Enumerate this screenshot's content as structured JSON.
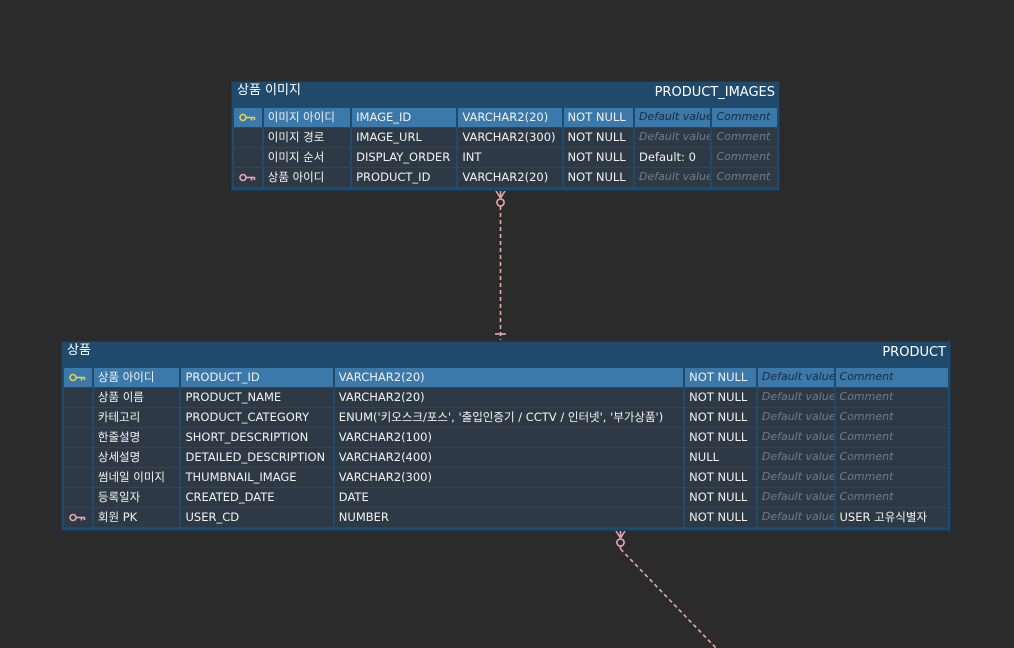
{
  "colors": {
    "canvas_bg": "#2b2b2b",
    "entity_bg": "#1f4a6b",
    "cell_bg": "#2d3a46",
    "selected_row_bg": "#3a79aa",
    "pk_key": "#e3d24a",
    "fk_key": "#e8a6b3",
    "relation_line": "#e8a6b3"
  },
  "entities": {
    "product_images": {
      "logical_name": "상품 이미지",
      "physical_name": "PRODUCT_IMAGES",
      "rows": [
        {
          "key": "pk-key-icon",
          "logical": "이미지 아이디",
          "physical": "IMAGE_ID",
          "type": "VARCHAR2(20)",
          "nullable": "NOT NULL",
          "default": "Default value",
          "comment": "Comment",
          "selected": true
        },
        {
          "key": "",
          "logical": "이미지 경로",
          "physical": "IMAGE_URL",
          "type": "VARCHAR2(300)",
          "nullable": "NOT NULL",
          "default": "Default value",
          "comment": "Comment"
        },
        {
          "key": "",
          "logical": "이미지 순서",
          "physical": "DISPLAY_ORDER",
          "type": "INT",
          "nullable": "NOT NULL",
          "default": "Default: 0",
          "default_set": true,
          "comment": "Comment"
        },
        {
          "key": "fk-key-icon",
          "logical": "상품 아이디",
          "physical": "PRODUCT_ID",
          "type": "VARCHAR2(20)",
          "nullable": "NOT NULL",
          "default": "Default value",
          "comment": "Comment"
        }
      ]
    },
    "product": {
      "logical_name": "상품",
      "physical_name": "PRODUCT",
      "rows": [
        {
          "key": "pk-key-icon",
          "logical": "상품 아이디",
          "physical": "PRODUCT_ID",
          "type": "VARCHAR2(20)",
          "nullable": "NOT NULL",
          "default": "Default value",
          "comment": "Comment",
          "selected": true
        },
        {
          "key": "",
          "logical": "상품 이름",
          "physical": "PRODUCT_NAME",
          "type": "VARCHAR2(20)",
          "nullable": "NOT NULL",
          "default": "Default value",
          "comment": "Comment"
        },
        {
          "key": "",
          "logical": "카테고리",
          "physical": "PRODUCT_CATEGORY",
          "type": "ENUM('키오스크/포스', '출입인증기 / CCTV / 인터넷', '부가상품')",
          "nullable": "NOT NULL",
          "default": "Default value",
          "comment": "Comment"
        },
        {
          "key": "",
          "logical": "한줄설명",
          "physical": "SHORT_DESCRIPTION",
          "type": "VARCHAR2(100)",
          "nullable": "NOT NULL",
          "default": "Default value",
          "comment": "Comment"
        },
        {
          "key": "",
          "logical": "상세설명",
          "physical": "DETAILED_DESCRIPTION",
          "type": "VARCHAR2(400)",
          "nullable": "NULL",
          "default": "Default value",
          "comment": "Comment"
        },
        {
          "key": "",
          "logical": "썸네일 이미지",
          "physical": "THUMBNAIL_IMAGE",
          "type": "VARCHAR2(300)",
          "nullable": "NOT NULL",
          "default": "Default value",
          "comment": "Comment"
        },
        {
          "key": "",
          "logical": "등록일자",
          "physical": "CREATED_DATE",
          "type": "DATE",
          "nullable": "NOT NULL",
          "default": "Default value",
          "comment": "Comment"
        },
        {
          "key": "fk-key-icon",
          "logical": "회원 PK",
          "physical": "USER_CD",
          "type": "NUMBER",
          "nullable": "NOT NULL",
          "default": "Default value",
          "comment": "USER 고유식별자",
          "comment_set": true
        }
      ]
    }
  }
}
